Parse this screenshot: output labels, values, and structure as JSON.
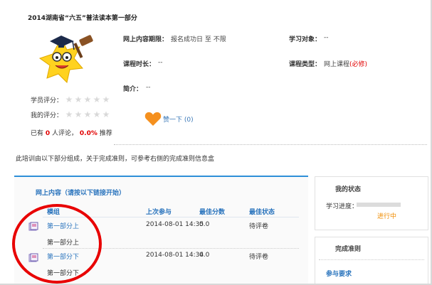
{
  "course": {
    "title": "2014湖南省“六五”普法读本第一部分"
  },
  "details": {
    "online_label": "网上内容期限：",
    "online_value": "报名成功日 至 不限",
    "target_label": "学习对象：",
    "target_value": "--",
    "duration_label": "课程时长：",
    "duration_value": "--",
    "type_label": "课程类型：",
    "type_value": "网上课程",
    "type_tag": "(必修)",
    "intro_label": "简介：",
    "intro_value": "--"
  },
  "ratings": {
    "student_label": "学员评分：",
    "my_label": "我的评分：",
    "stars_student": 0,
    "stars_mine": 0,
    "comment_prefix": "已有",
    "comment_count": "0",
    "comment_mid": "人评论，",
    "recommend_pct": "0.0%",
    "recommend_suffix": "推荐"
  },
  "like": {
    "label": "赞一下 (0)"
  },
  "note": "此培训由以下部分组成，关于完成准则，可参考右侧的完成准则信息盒",
  "main_panel": {
    "heading": "网上内容（请按以下链接开始）",
    "columns": [
      "模组",
      "上次参与",
      "最佳分数",
      "最佳状态"
    ],
    "rows": [
      {
        "module": "第一部分上",
        "sub": "第一部分上",
        "last": "2014-08-01 14:35",
        "score": "0.0",
        "status": "待评卷"
      },
      {
        "module": "第一部分下",
        "sub": "第一部分下",
        "last": "2014-08-01 14:34",
        "score": "0.0",
        "status": "待评卷"
      }
    ]
  },
  "side": {
    "status_title": "我的状态",
    "progress_label": "学习进度：",
    "progress_value": 0,
    "progress_text": "进行中",
    "criteria_title": "完成准则",
    "requirement_link": "参与要求"
  },
  "colors": {
    "accent_blue": "#2e8fd8",
    "link_blue": "#2a74bd",
    "required_red": "#e10000",
    "annotation_red": "#e80000",
    "progress_orange": "#f08c00",
    "heart_orange": "#f5901e"
  }
}
